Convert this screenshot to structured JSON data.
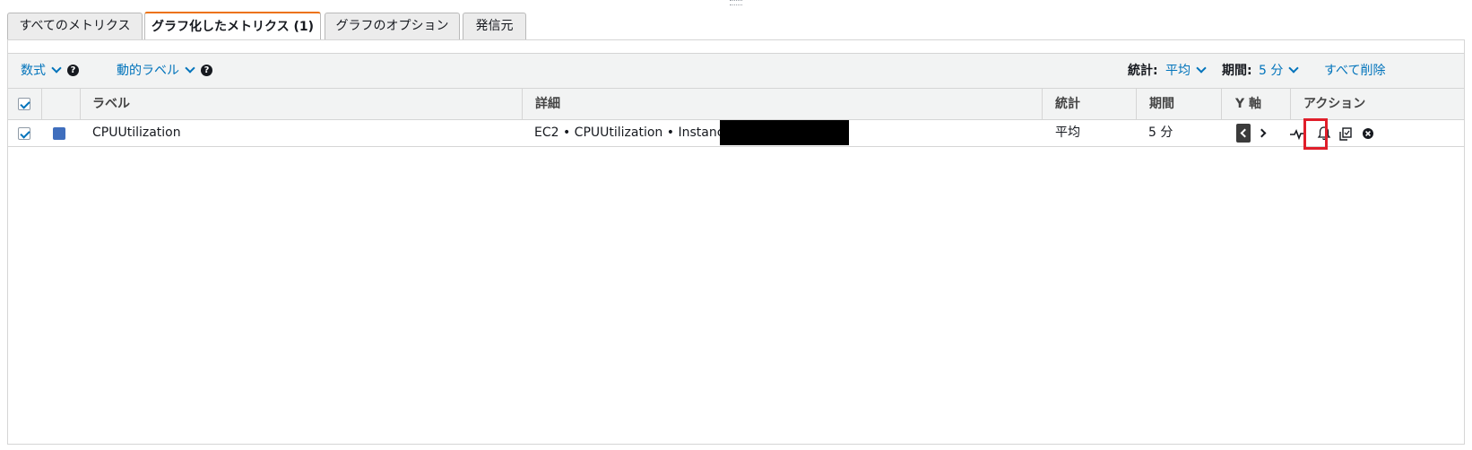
{
  "tabs": [
    {
      "label": "すべてのメトリクス",
      "active": false
    },
    {
      "label": "グラフ化したメトリクス (1)",
      "active": true
    },
    {
      "label": "グラフのオプション",
      "active": false
    },
    {
      "label": "発信元",
      "active": false
    }
  ],
  "toolbar": {
    "math_label": "数式",
    "dynamic_label": "動的ラベル",
    "stat_label": "統計:",
    "stat_value": "平均",
    "period_label": "期間:",
    "period_value": "5 分",
    "delete_all": "すべて削除"
  },
  "table": {
    "headers": {
      "label": "ラベル",
      "details": "詳細",
      "stat": "統計",
      "period": "期間",
      "yaxis": "Y 軸",
      "actions": "アクション"
    },
    "rows": [
      {
        "checked": true,
        "color": "#3f6ebd",
        "label": "CPUUtilization",
        "details": "EC2 • CPUUtilization • InstanceId:",
        "stat": "平均",
        "period": "5 分",
        "yaxis": "left"
      }
    ]
  },
  "icons": {
    "actions": [
      "graph-icon",
      "bell-icon",
      "copy-icon",
      "remove-icon"
    ]
  },
  "colors": {
    "link": "#0073bb",
    "tab_accent": "#ec7211",
    "highlight": "#e01e2a"
  }
}
